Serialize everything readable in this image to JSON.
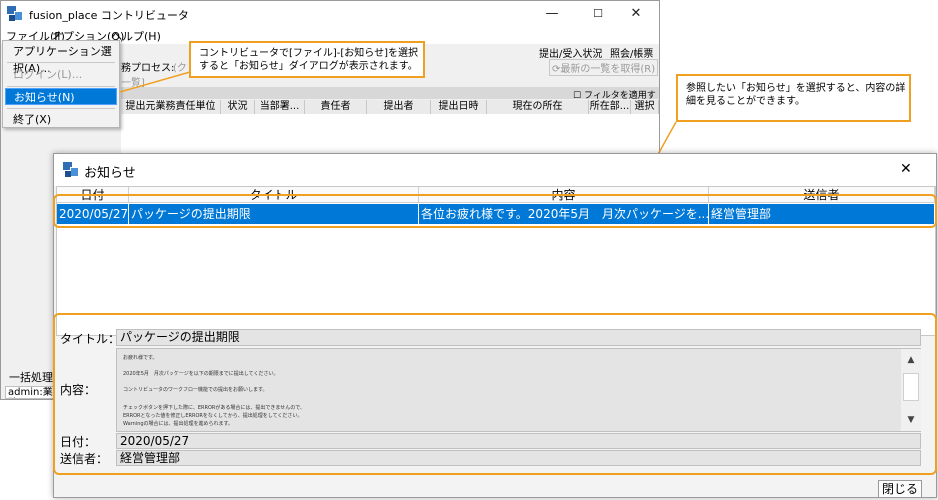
{
  "main_window": {
    "title": "fusion_place コントリビュータ",
    "controls": {
      "minimize": "—",
      "maximize": "☐",
      "close": "✕"
    },
    "menu": [
      "ファイル(F)",
      "オプション(Q)",
      "ヘルプ(H)"
    ],
    "dropdown": {
      "items": [
        "アプリケーション選択(A)...",
        "ログイン(L)...",
        "お知らせ(N)",
        "終了(X)"
      ]
    },
    "right_labels": {
      "status": "提出/受入状況",
      "inquiry": "照会/帳票",
      "refresh": "⟳最新の一覧を取得(R)"
    },
    "business_process_label": "務プロセス:",
    "business_process_value": "(ク",
    "list_label": "一覧]",
    "filter_label": "フィルタを適用する",
    "grid_columns": [
      "提出元業務責任単位",
      "状況",
      "当部署...",
      "責任者",
      "提出者",
      "提出日時",
      "現在の所在",
      "所在部...",
      "選択"
    ],
    "batch_label": "一括処理",
    "status_bar": "admin:業務"
  },
  "callouts": {
    "menu_callout": "コントリビュータで[ファイル]-[お知らせ]を選択すると「お知らせ」ダイアログが表示されます。",
    "detail_callout": "参照したい「お知らせ」を選択すると、内容の詳細を見ることができます。"
  },
  "dialog": {
    "title": "お知らせ",
    "close_icon": "✕",
    "columns": [
      "日付",
      "タイトル",
      "内容",
      "送信者"
    ],
    "row": {
      "date": "2020/05/27",
      "title": "パッケージの提出期限",
      "content": "各位お疲れ様です。2020年5月　月次パッケージを...",
      "sender": "経営管理部"
    },
    "detail": {
      "title_label": "タイトル：",
      "title_value": "パッケージの提出期限",
      "content_label": "内容：",
      "content_lines": [
        "お疲れ様です。",
        "2020年5月　月次パッケージを以下の期限までに提出してください。",
        "コントリビュータのワークフロー機能での提出をお願いします。",
        "チェックボタンを押下した際に、ERRORがある場合には、提出できませんので、",
        "ERRORとなった値を修正しERRORをなくしてから、提出処理をしてください。",
        "Warningの場合には、提出処理を進められます。"
      ],
      "date_label": "日付：",
      "date_value": "2020/05/27",
      "sender_label": "送信者：",
      "sender_value": "経営管理部"
    },
    "close_button": "閉じる"
  },
  "colors": {
    "accent": "#0078d7",
    "callout_border": "#f0a020"
  }
}
